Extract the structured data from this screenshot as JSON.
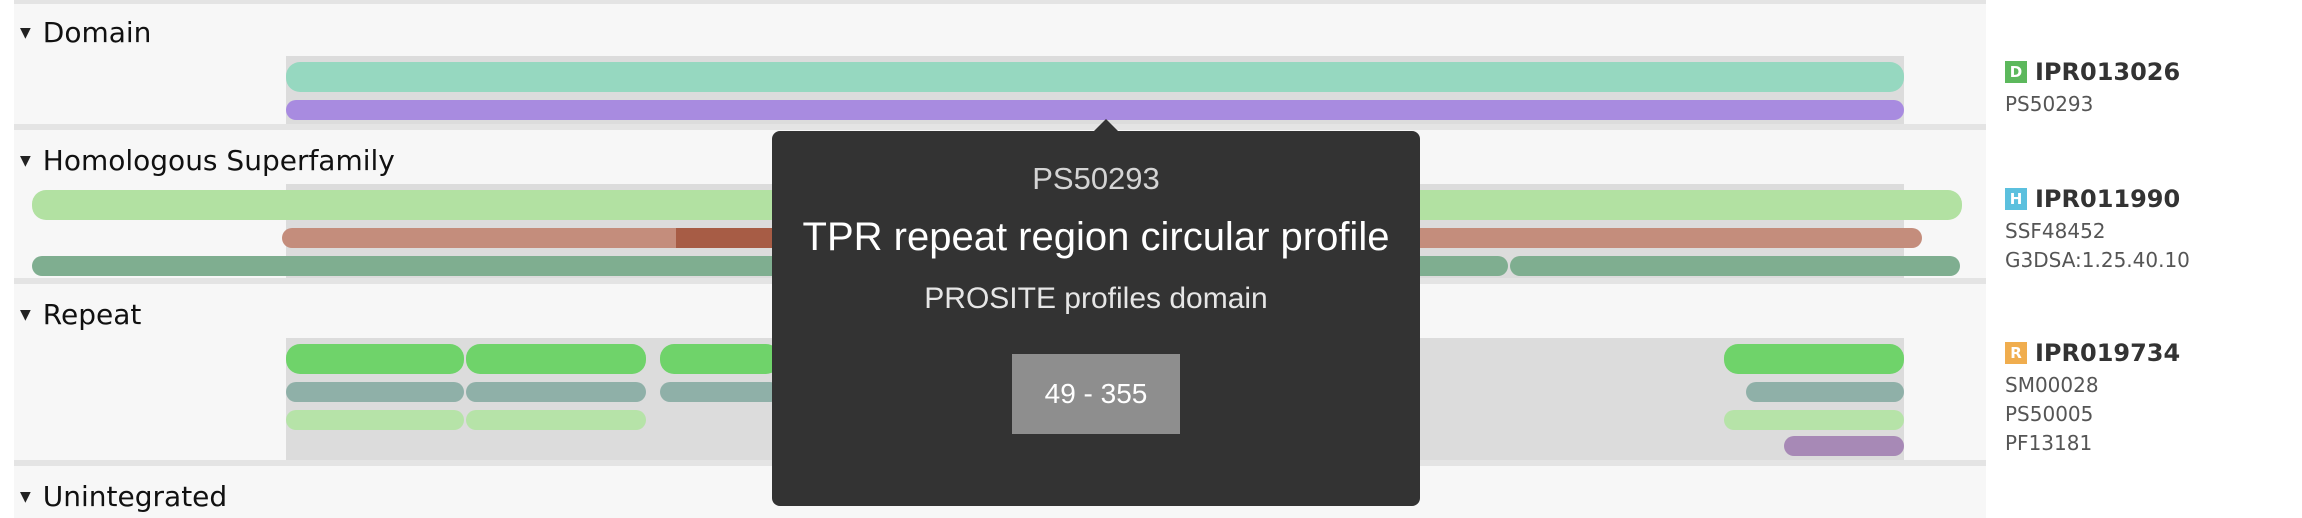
{
  "sections": {
    "domain": "Domain",
    "homologous": "Homologous Superfamily",
    "repeat": "Repeat",
    "unintegrated": "Unintegrated"
  },
  "entries": [
    {
      "type_letter": "D",
      "type": "domain",
      "accession": "IPR013026",
      "members": [
        "PS50293"
      ],
      "color": "#5cb85c"
    },
    {
      "type_letter": "H",
      "type": "homologous_superfamily",
      "accession": "IPR011990",
      "members": [
        "SSF48452",
        "G3DSA:1.25.40.10"
      ],
      "color": "#5bc0de"
    },
    {
      "type_letter": "R",
      "type": "repeat",
      "accession": "IPR019734",
      "members": [
        "SM00028",
        "PS50005",
        "PF13181"
      ],
      "color": "#f0ad4e"
    }
  ],
  "tooltip": {
    "id": "PS50293",
    "title": "TPR repeat region circular profile",
    "type": "PROSITE profiles domain",
    "range": "49 - 355"
  },
  "colors": {
    "domain_entry": "#96d8c0",
    "domain_member": "#a88be0",
    "homologous_entry": "#b2e1a2",
    "ssf": "#c48d7c",
    "gene3d": "#7fae90",
    "repeat_entry": "#6fd36a",
    "sm": "#8fb0a8",
    "ps": "#b6e3a8",
    "pf": "#a789b6"
  }
}
